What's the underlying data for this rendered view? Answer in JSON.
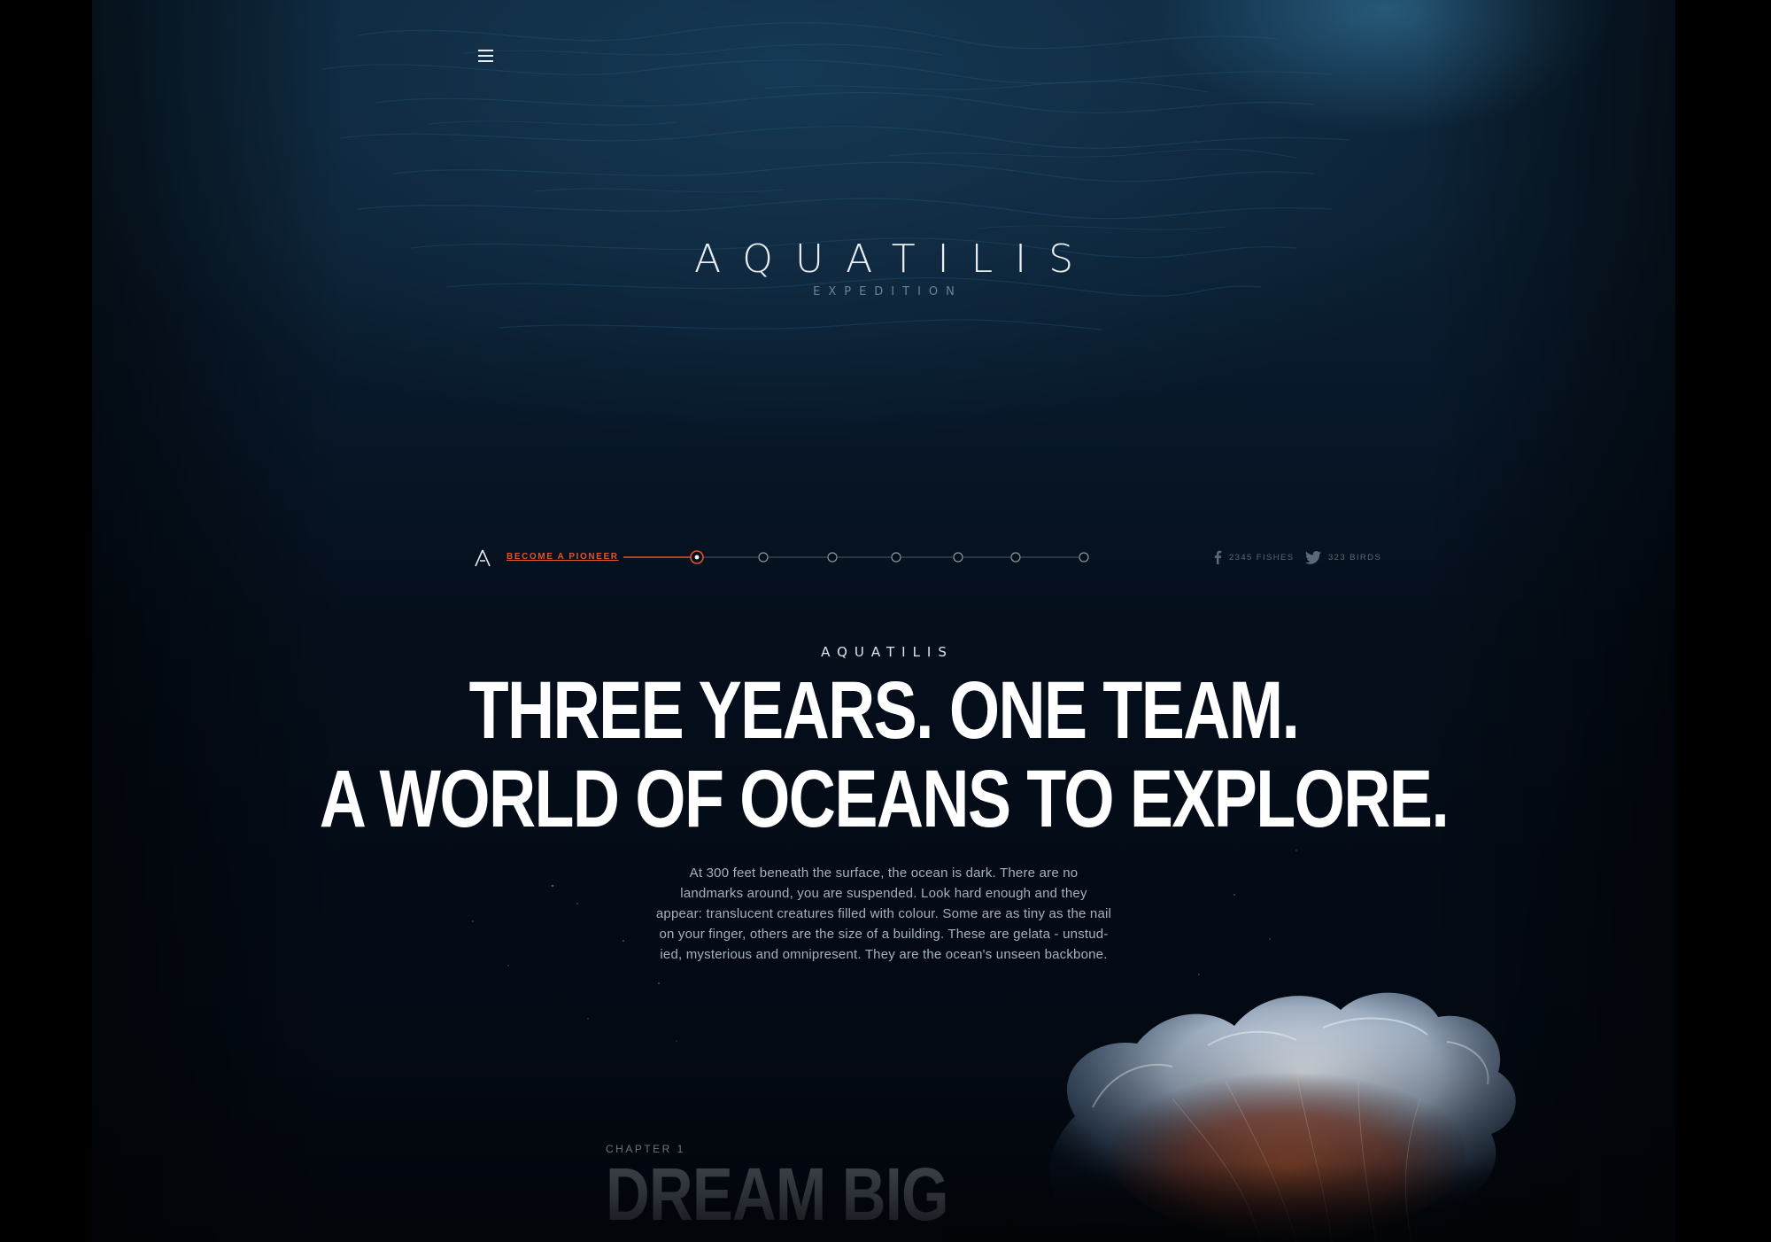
{
  "header": {
    "menu_icon": "hamburger-menu-icon"
  },
  "hero": {
    "logo_wordmark": "AQUATILIS",
    "logo_subtitle": "EXPEDITION"
  },
  "navbar": {
    "logo_icon": "aquatilis-a-logo-icon",
    "pioneer_label": "BECOME A PIONEER",
    "progress": {
      "total_steps": 7,
      "active_step": 1
    },
    "accent_color": "#e0552a",
    "social": {
      "facebook": {
        "icon": "facebook-icon",
        "count_label": "2345 FISHES"
      },
      "twitter": {
        "icon": "twitter-icon",
        "count_label": "323 BIRDS"
      }
    }
  },
  "intro": {
    "brand": "AQUATILIS",
    "headline_line1": "THREE YEARS. ONE TEAM.",
    "headline_line2": "A WORLD OF OCEANS TO EXPLORE.",
    "body_lines": [
      "At 300 feet beneath the surface, the ocean is dark. There are no",
      "landmarks around, you are suspended. Look hard enough and they",
      "appear: translucent creatures filled with colour. Some are as tiny as the nail",
      "on your finger, others are the size of a building. These are gelata - unstud-",
      "ied, mysterious and omnipresent. They are the ocean's unseen backbone."
    ]
  },
  "chapter": {
    "label": "CHAPTER 1",
    "title": "DREAM BIG"
  }
}
